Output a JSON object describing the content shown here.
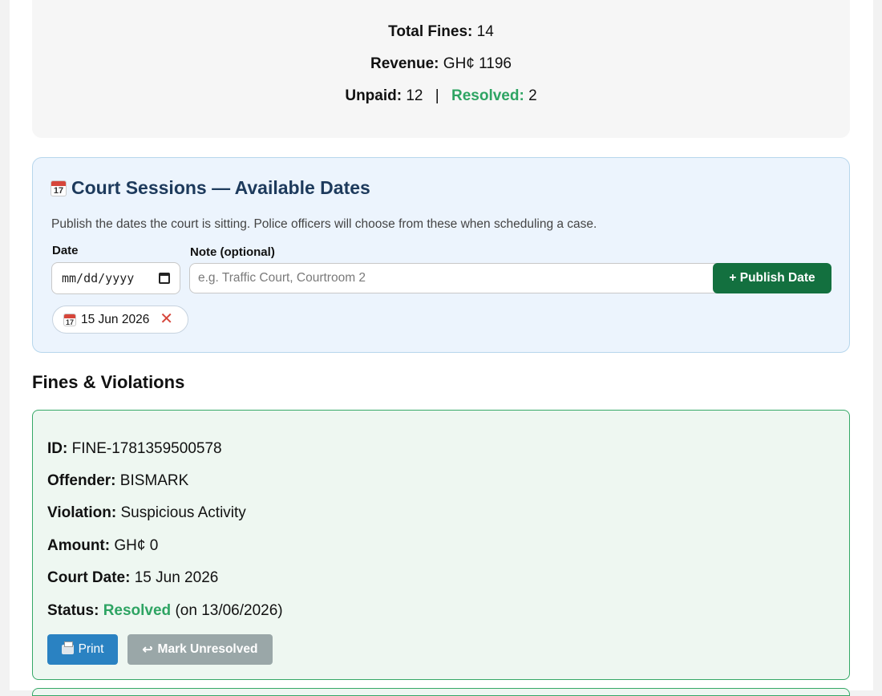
{
  "stats": {
    "total_label": "Total Fines:",
    "total_value": "14",
    "revenue_label": "Revenue:",
    "revenue_value": "GH¢ 1196",
    "unpaid_label": "Unpaid:",
    "unpaid_value": "12",
    "separator": "|",
    "resolved_label": "Resolved:",
    "resolved_value": "2"
  },
  "court": {
    "icon_day": "17",
    "title": "Court Sessions — Available Dates",
    "description": "Publish the dates the court is sitting. Police officers will choose from these when scheduling a case.",
    "date_label": "Date",
    "date_placeholder": "mm/dd/yyyy",
    "note_label": "Note (optional)",
    "note_placeholder": "e.g. Traffic Court, Courtroom 2",
    "publish_label": "+ Publish Date",
    "chips": [
      {
        "label": "15 Jun 2026",
        "remove": "✕"
      }
    ]
  },
  "fines": {
    "section_title": "Fines & Violations",
    "items": [
      {
        "id_label": "ID:",
        "id": "FINE-1781359500578",
        "offender_label": "Offender:",
        "offender": "BISMARK",
        "violation_label": "Violation:",
        "violation": "Suspicious Activity",
        "amount_label": "Amount:",
        "amount": "GH¢ 0",
        "court_date_label": "Court Date:",
        "court_date": "15 Jun 2026",
        "status_label": "Status:",
        "status": "Resolved",
        "status_note": "(on 13/06/2026)",
        "print_label": "Print",
        "unresolve_icon": "↩",
        "unresolve_label": "Mark Unresolved"
      }
    ]
  },
  "colors": {
    "resolved_green": "#2ea463",
    "publish_green": "#13703f",
    "print_blue": "#2a82c2",
    "muted_button": "#9aa7a8",
    "remove_red": "#d6453a"
  }
}
